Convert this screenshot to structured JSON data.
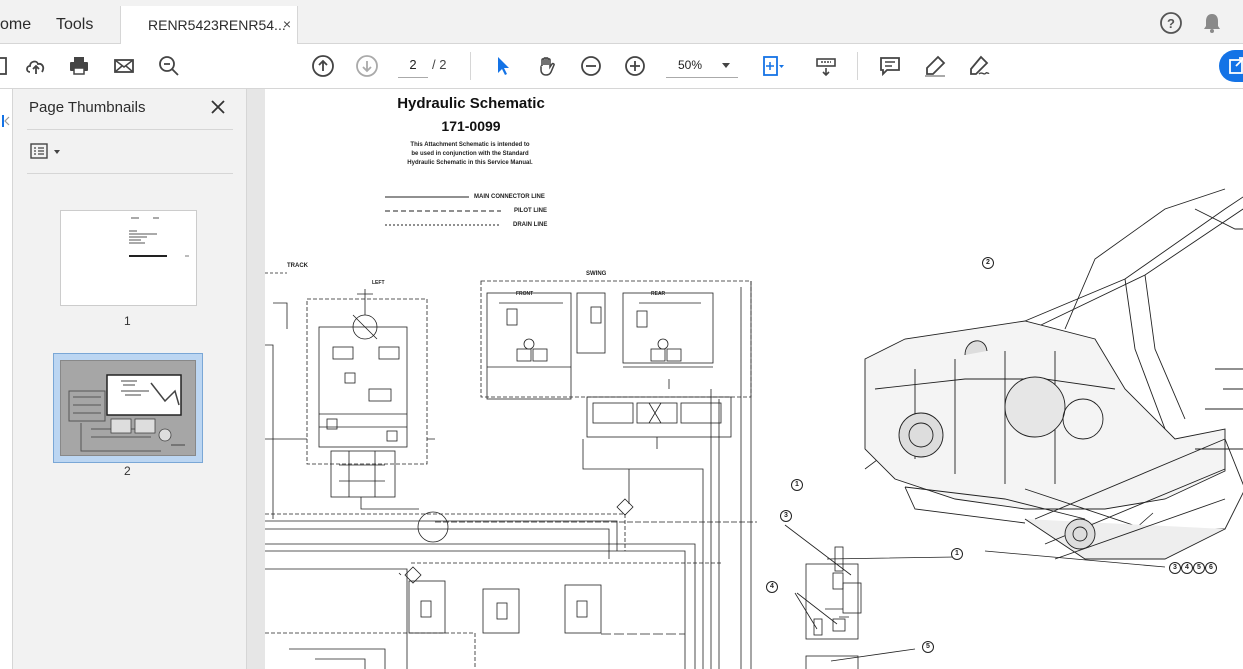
{
  "tabs": {
    "home": "ome",
    "tools": "Tools",
    "document": "RENR5423RENR54...",
    "close": "×"
  },
  "toolbar": {
    "current_page": "2",
    "total_pages": "/ 2",
    "zoom": "50%",
    "icons": [
      "upload-cloud-icon",
      "print-icon",
      "mail-icon",
      "search-zoom-icon",
      "page-up-icon",
      "page-down-icon",
      "zoom-out-icon",
      "zoom-in-icon",
      "select-arrow-icon",
      "hand-icon",
      "fit-page-icon",
      "scroll-mode-icon",
      "comment-icon",
      "highlight-pen-icon",
      "sign-icon"
    ]
  },
  "sidebar": {
    "title": "Page Thumbnails",
    "thumbnails": [
      {
        "label": "1",
        "selected": false
      },
      {
        "label": "2",
        "selected": true
      }
    ]
  },
  "document": {
    "title": "Hydraulic Schematic",
    "number": "171-0099",
    "note_line1": "This Attachment Schematic is intended to",
    "note_line2": "be used in conjunction with the Standard",
    "note_line3": "Hydraulic Schematic in this Service Manual.",
    "legend": {
      "main": "MAIN CONNECTOR LINE",
      "pilot": "PILOT LINE",
      "drain": "DRAIN LINE"
    },
    "labels": {
      "track": "TRACK",
      "swing": "SWING",
      "left": "LEFT",
      "front": "FRONT",
      "rear": "REAR"
    },
    "callouts": [
      "2",
      "1",
      "3",
      "1",
      "4",
      "5",
      "3",
      "4",
      "5",
      "6"
    ]
  },
  "colors": {
    "accent": "#1473e6",
    "selection": "#bcd6f2"
  }
}
